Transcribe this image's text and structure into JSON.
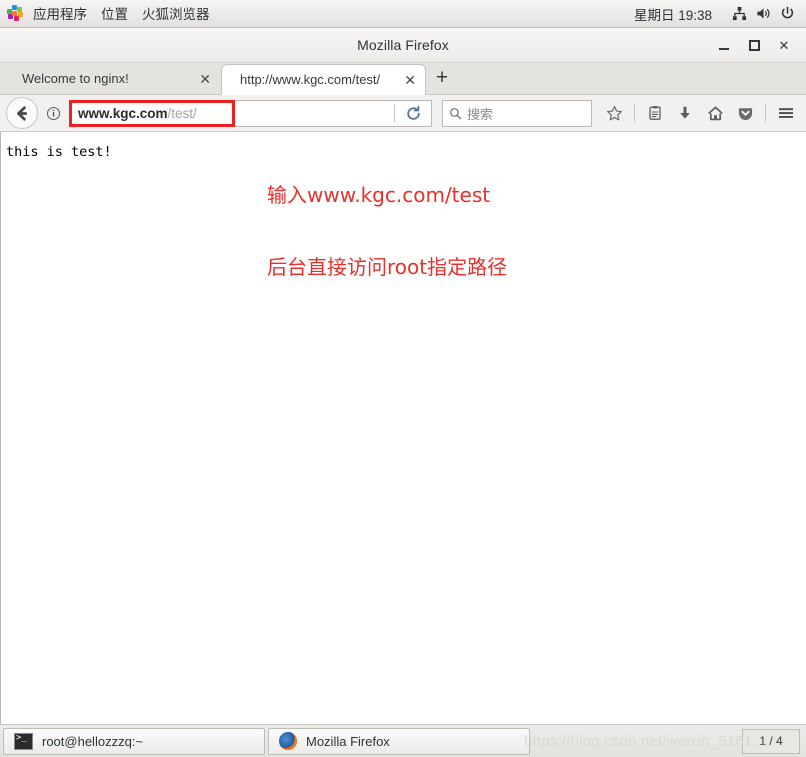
{
  "desktop": {
    "panel": {
      "apps_icon": "applications-pinwheel-icon",
      "menus": [
        {
          "label": "应用程序",
          "name": "applications"
        },
        {
          "label": "位置",
          "name": "places"
        },
        {
          "label": "火狐浏览器",
          "name": "firefox"
        }
      ],
      "clock": "星期日 19:38",
      "tray_icons": [
        {
          "name": "network-icon"
        },
        {
          "name": "volume-icon"
        },
        {
          "name": "power-icon"
        }
      ]
    },
    "taskbar": {
      "items": [
        {
          "label": "root@hellozzzq:~",
          "icon": "terminal-icon"
        },
        {
          "label": "Mozilla Firefox",
          "icon": "firefox-icon"
        }
      ],
      "workspace": "1 / 4"
    },
    "watermark": "https://blog.csdn.net/weixin_5161..."
  },
  "browser": {
    "window_title": "Mozilla Firefox",
    "window_controls": {
      "minimize": "minimize",
      "maximize": "maximize",
      "close": "✕"
    },
    "tabs": [
      {
        "label": "Welcome to nginx!",
        "active": false,
        "close": "✕"
      },
      {
        "label": "http://www.kgc.com/test/",
        "active": true,
        "close": "✕"
      }
    ],
    "new_tab_label": "+",
    "toolbar": {
      "back_icon": "back-arrow-icon",
      "info_icon": "page-info-icon",
      "url_domain": "www.kgc.com",
      "url_path": "/test/",
      "url_prefix": "",
      "reload_icon": "reload-icon",
      "search_placeholder": "搜索",
      "search_value": "",
      "icons": [
        {
          "name": "bookmark-star-icon",
          "glyph": "☆"
        },
        {
          "name": "library-icon",
          "glyph": "▤"
        },
        {
          "name": "downloads-icon",
          "glyph": "⬇"
        },
        {
          "name": "home-icon",
          "glyph": "⌂"
        },
        {
          "name": "pocket-icon",
          "glyph": "▼"
        },
        {
          "name": "menu-hamburger-icon",
          "glyph": "☰"
        }
      ],
      "url_highlight_color": "#ef2020"
    },
    "page": {
      "body_text": "this is test!",
      "annotations": [
        "输入www.kgc.com/test",
        "后台直接访问root指定路径"
      ],
      "annotation_color": "#e8312b"
    }
  }
}
